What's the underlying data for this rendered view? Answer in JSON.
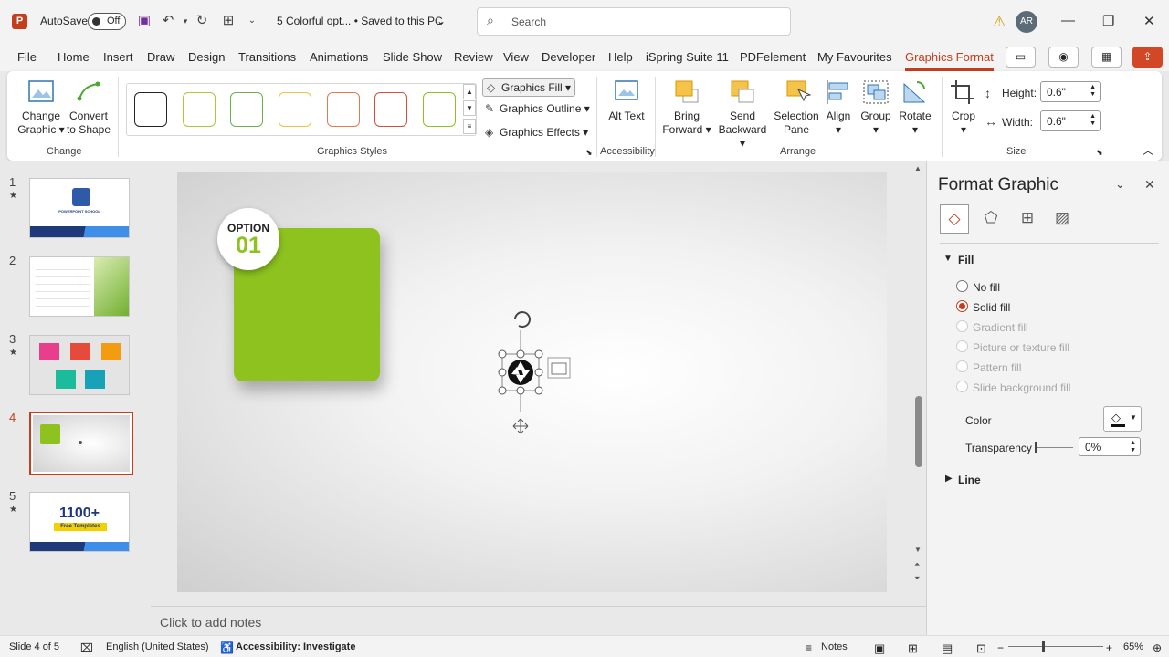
{
  "app": {
    "logo": "P",
    "autosave_label": "AutoSave",
    "autosave_state": "Off",
    "doc_title": "5 Colorful opt... • Saved to this PC",
    "search_placeholder": "Search",
    "user_initials": "AR"
  },
  "menu": [
    "File",
    "Home",
    "Insert",
    "Draw",
    "Design",
    "Transitions",
    "Animations",
    "Slide Show",
    "Review",
    "View",
    "Developer",
    "Help",
    "iSpring Suite 11",
    "PDFelement",
    "My Favourites",
    "Graphics Format"
  ],
  "ribbon": {
    "change_graphic": "Change Graphic",
    "convert_to_shape": "Convert to Shape",
    "group_change": "Change",
    "group_styles": "Graphics Styles",
    "style_colors": [
      "#222222",
      "#a9c83a",
      "#6fae4c",
      "#e8c53a",
      "#e07b4f",
      "#d1503d",
      "#8dc21f"
    ],
    "graphics_fill": "Graphics Fill",
    "graphics_outline": "Graphics Outline",
    "graphics_effects": "Graphics Effects",
    "alt_text": "Alt Text",
    "group_accessibility": "Accessibility",
    "bring_forward": "Bring Forward",
    "send_backward": "Send Backward",
    "selection_pane": "Selection Pane",
    "align": "Align",
    "group": "Group",
    "rotate": "Rotate",
    "group_arrange": "Arrange",
    "crop": "Crop",
    "height_label": "Height:",
    "height_value": "0.6\"",
    "width_label": "Width:",
    "width_value": "0.6\"",
    "group_size": "Size"
  },
  "slides": [
    {
      "num": "1",
      "star": "★"
    },
    {
      "num": "2",
      "star": ""
    },
    {
      "num": "3",
      "star": "★"
    },
    {
      "num": "4",
      "star": ""
    },
    {
      "num": "5",
      "star": "★"
    }
  ],
  "thumb_text": {
    "s1_brand": "POWERPOINT SCHOOL",
    "s5_big": "1100+",
    "s5_sub": "Free Templates"
  },
  "slide_content": {
    "option_label": "OPTION",
    "option_number": "01",
    "card_color": "#8dc21f"
  },
  "notes_placeholder": "Click to add notes",
  "pane": {
    "title": "Format Graphic",
    "section_fill": "Fill",
    "options": [
      "No fill",
      "Solid fill",
      "Gradient fill",
      "Picture or texture fill",
      "Pattern fill",
      "Slide background fill"
    ],
    "color_label": "Color",
    "transparency_label": "Transparency",
    "transparency_value": "0%",
    "section_line": "Line"
  },
  "status": {
    "slide": "Slide 4 of 5",
    "language": "English (United States)",
    "accessibility": "Accessibility: Investigate",
    "notes": "Notes",
    "zoom": "65%"
  },
  "colors": {
    "accent": "#c43e1c",
    "green": "#8dc21f"
  }
}
